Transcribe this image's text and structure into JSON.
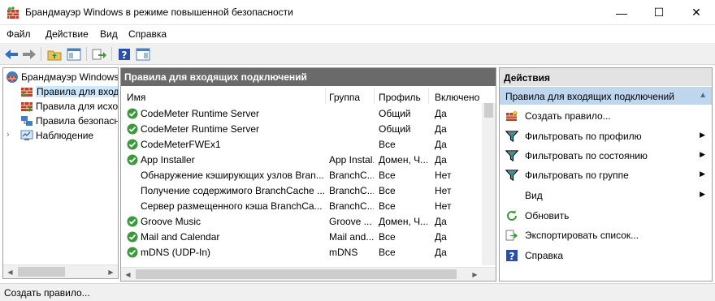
{
  "window": {
    "title": "Брандмауэр Windows в режиме повышенной безопасности",
    "minimize_glyph": "—",
    "maximize_glyph": "☐",
    "close_glyph": "✕"
  },
  "menu": [
    "Файл",
    "Действие",
    "Вид",
    "Справка"
  ],
  "toolbar": {
    "buttons": [
      "back-icon",
      "forward-icon",
      "up-folder-icon",
      "show-hide-tree-icon",
      "export-list-icon",
      "help-icon",
      "action-pane-icon"
    ]
  },
  "tree": {
    "root": "Брандмауэр Windows в режиме повышенной безопасности",
    "items": [
      {
        "label": "Правила для входящих подключений",
        "selected": true
      },
      {
        "label": "Правила для исходящих подключений",
        "selected": false
      },
      {
        "label": "Правила безопасности подключений",
        "selected": false
      },
      {
        "label": "Наблюдение",
        "selected": false
      }
    ]
  },
  "rules_panel": {
    "header": "Правила для входящих подключений",
    "columns": [
      "Имя",
      "Группа",
      "Профиль",
      "Включено"
    ],
    "rows": [
      {
        "enabled_icon": true,
        "name": "CodeMeter Runtime Server",
        "group": "",
        "profile": "Общий",
        "enabled": "Да"
      },
      {
        "enabled_icon": true,
        "name": "CodeMeter Runtime Server",
        "group": "",
        "profile": "Общий",
        "enabled": "Да"
      },
      {
        "enabled_icon": true,
        "name": "CodeMeterFWEx1",
        "group": "",
        "profile": "Все",
        "enabled": "Да"
      },
      {
        "enabled_icon": true,
        "name": "App Installer",
        "group": "App Instal...",
        "profile": "Домен, Ч...",
        "enabled": "Да"
      },
      {
        "enabled_icon": false,
        "name": "Обнаружение кэширующих узлов Bran...",
        "group": "BranchC...",
        "profile": "Все",
        "enabled": "Нет"
      },
      {
        "enabled_icon": false,
        "name": "Получение содержимого BranchCache ...",
        "group": "BranchC...",
        "profile": "Все",
        "enabled": "Нет"
      },
      {
        "enabled_icon": false,
        "name": "Сервер размещенного кэша BranchCa...",
        "group": "BranchC...",
        "profile": "Все",
        "enabled": "Нет"
      },
      {
        "enabled_icon": true,
        "name": "Groove Music",
        "group": "Groove ...",
        "profile": "Домен, Ч...",
        "enabled": "Да"
      },
      {
        "enabled_icon": true,
        "name": "Mail and Calendar",
        "group": "Mail and...",
        "profile": "Все",
        "enabled": "Да"
      },
      {
        "enabled_icon": true,
        "name": "mDNS (UDP-In)",
        "group": "mDNS",
        "profile": "Все",
        "enabled": "Да"
      }
    ]
  },
  "actions": {
    "header": "Действия",
    "section": "Правила для входящих подключений",
    "items": [
      {
        "label": "Создать правило...",
        "icon": "new-rule-icon",
        "submenu": false
      },
      {
        "label": "Фильтровать по профилю",
        "icon": "filter-icon",
        "submenu": true
      },
      {
        "label": "Фильтровать по состоянию",
        "icon": "filter-icon",
        "submenu": true
      },
      {
        "label": "Фильтровать по группе",
        "icon": "filter-icon",
        "submenu": true
      },
      {
        "label": "Вид",
        "icon": "",
        "submenu": true
      },
      {
        "label": "Обновить",
        "icon": "refresh-icon",
        "submenu": false
      },
      {
        "label": "Экспортировать список...",
        "icon": "export-icon",
        "submenu": false
      },
      {
        "label": "Справка",
        "icon": "help-icon",
        "submenu": false
      }
    ]
  },
  "status": "Создать правило..."
}
